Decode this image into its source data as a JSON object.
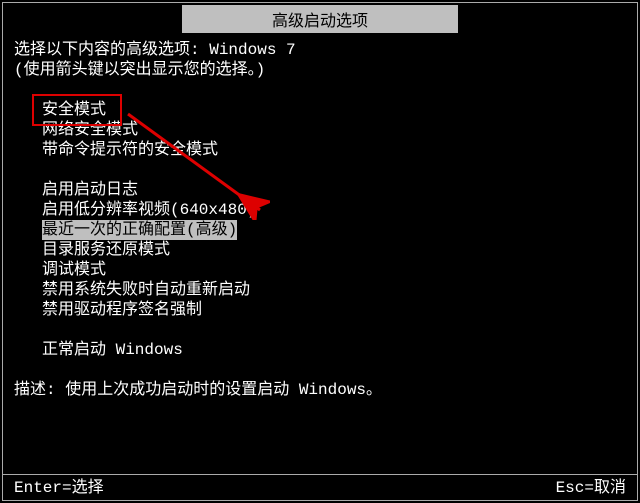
{
  "title": "高级启动选项",
  "intro_line1_prefix": "选择以下内容的高级选项: ",
  "intro_line1_os": "Windows 7",
  "intro_line2": "(使用箭头键以突出显示您的选择。)",
  "options": {
    "safe_mode": "安全模式",
    "safe_mode_networking": "网络安全模式",
    "safe_mode_cmd": "带命令提示符的安全模式",
    "boot_logging": "启用启动日志",
    "low_res_video": "启用低分辨率视频(640x480)",
    "last_known_good": "最近一次的正确配置(高级)",
    "ds_restore": "目录服务还原模式",
    "debug_mode": "调试模式",
    "disable_auto_restart": "禁用系统失败时自动重新启动",
    "disable_driver_sig": "禁用驱动程序签名强制",
    "start_normally": "正常启动 Windows"
  },
  "description_label": "描述: ",
  "description_text": "使用上次成功启动时的设置启动 Windows。",
  "footer_left": "Enter=选择",
  "footer_right": "Esc=取消",
  "annotation": {
    "highlighted_item": "safe_mode",
    "arrow_color": "#d00"
  }
}
